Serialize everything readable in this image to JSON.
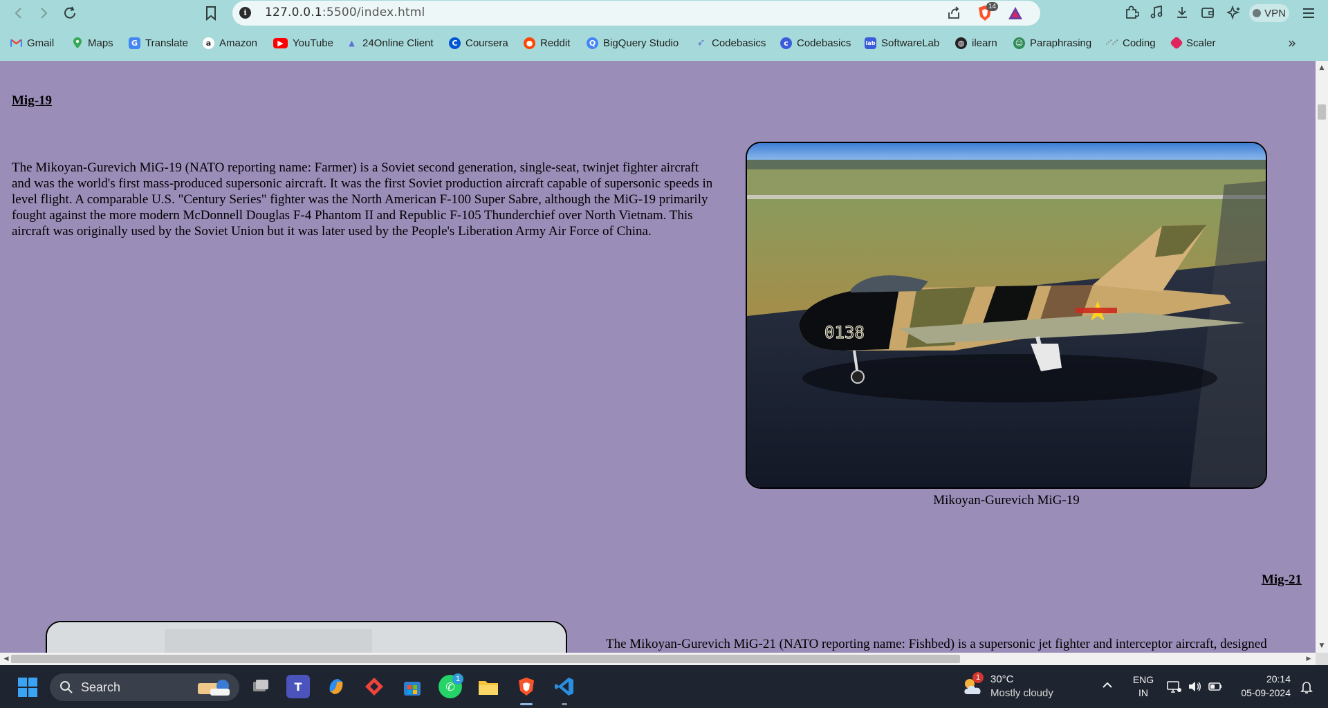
{
  "browser": {
    "url_host": "127.0.0.1",
    "url_rest": ":5500/index.html",
    "shield_count": "14",
    "vpn_label": "VPN",
    "bookmarks": [
      {
        "label": "Gmail",
        "icon": "gmail-icon",
        "color": "#ea4335"
      },
      {
        "label": "Maps",
        "icon": "maps-icon",
        "color": "#34a853"
      },
      {
        "label": "Translate",
        "icon": "translate-icon",
        "color": "#4285f4"
      },
      {
        "label": "Amazon",
        "icon": "amazon-icon",
        "color": "#222222"
      },
      {
        "label": "YouTube",
        "icon": "youtube-icon",
        "color": "#ff0000"
      },
      {
        "label": "24Online Client",
        "icon": "24online-icon",
        "color": "#5a6fd6"
      },
      {
        "label": "Coursera",
        "icon": "coursera-icon",
        "color": "#0056d2"
      },
      {
        "label": "Reddit",
        "icon": "reddit-icon",
        "color": "#ff4500"
      },
      {
        "label": "BigQuery Studio",
        "icon": "bigquery-icon",
        "color": "#4285f4"
      },
      {
        "label": "Codebasics",
        "icon": "rocket-icon",
        "color": "#5a6fd6"
      },
      {
        "label": "Codebasics",
        "icon": "codebasics-icon",
        "color": "#3b5bdb"
      },
      {
        "label": "SoftwareLab",
        "icon": "softwarelab-icon",
        "color": "#3b5bdb"
      },
      {
        "label": "ilearn",
        "icon": "globe-icon",
        "color": "#222222"
      },
      {
        "label": "Paraphrasing",
        "icon": "paraphrasing-icon",
        "color": "#2e8b57"
      },
      {
        "label": "Coding",
        "icon": "coding-icon",
        "color": "#999999"
      },
      {
        "label": "Scaler",
        "icon": "scaler-icon",
        "color": "#e0245e"
      }
    ]
  },
  "page": {
    "section1": {
      "heading": "Mig-19",
      "text": "The Mikoyan-Gurevich MiG-19 (NATO reporting name: Farmer) is a Soviet second generation, single-seat, twinjet fighter aircraft and was the world's first mass-produced supersonic aircraft. It was the first Soviet production aircraft capable of supersonic speeds in level flight. A comparable U.S. \"Century Series\" fighter was the North American F-100 Super Sabre, although the MiG-19 primarily fought against the more modern McDonnell Douglas F-4 Phantom II and Republic F-105 Thunderchief over North Vietnam. This aircraft was originally used by the Soviet Union but it was later used by the People's Liberation Army Air Force of China.",
      "caption": "Mikoyan-Gurevich MiG-19",
      "tail_number": "0138"
    },
    "section2": {
      "heading": "Mig-21",
      "text": "The Mikoyan-Gurevich MiG-21 (NATO reporting name: Fishbed) is a supersonic jet fighter and interceptor aircraft, designed"
    }
  },
  "taskbar": {
    "search_label": "Search",
    "whatsapp_badge": "1",
    "weather_badge": "1",
    "weather_temp": "30°C",
    "weather_desc": "Mostly cloudy",
    "lang_line1": "ENG",
    "lang_line2": "IN",
    "time": "20:14",
    "date": "05-09-2024"
  },
  "colors": {
    "page_background": "#9a8db8",
    "chrome_background": "#a6d9d9",
    "taskbar_background": "#1f2530"
  }
}
